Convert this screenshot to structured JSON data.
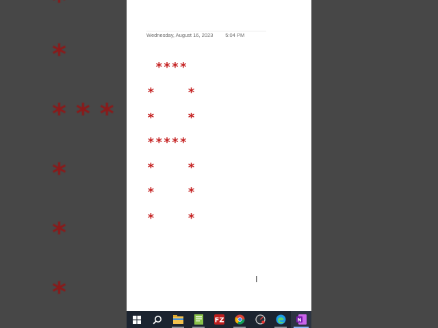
{
  "background_zoom": {
    "lines": [
      "*",
      "*",
      "* * *",
      "*",
      "*",
      "*"
    ]
  },
  "document": {
    "date": "Wednesday, August 16, 2023",
    "time": "5:04 PM",
    "lines": [
      " ****",
      "*    *",
      "*    *",
      "*****",
      "*    *",
      "*    *",
      "*    *"
    ]
  },
  "taskbar": {
    "items": [
      {
        "icon": "windows-start-icon"
      },
      {
        "icon": "search-icon"
      },
      {
        "icon": "file-explorer-icon"
      },
      {
        "icon": "notepad-icon"
      },
      {
        "icon": "filezilla-icon"
      },
      {
        "icon": "chrome-icon"
      },
      {
        "icon": "speed-clock-icon"
      },
      {
        "icon": "edge-icon"
      },
      {
        "icon": "onenote-icon"
      }
    ]
  },
  "colors": {
    "star": "#c41e1e",
    "taskbar": "#1c2430",
    "backdrop": "#474747"
  }
}
